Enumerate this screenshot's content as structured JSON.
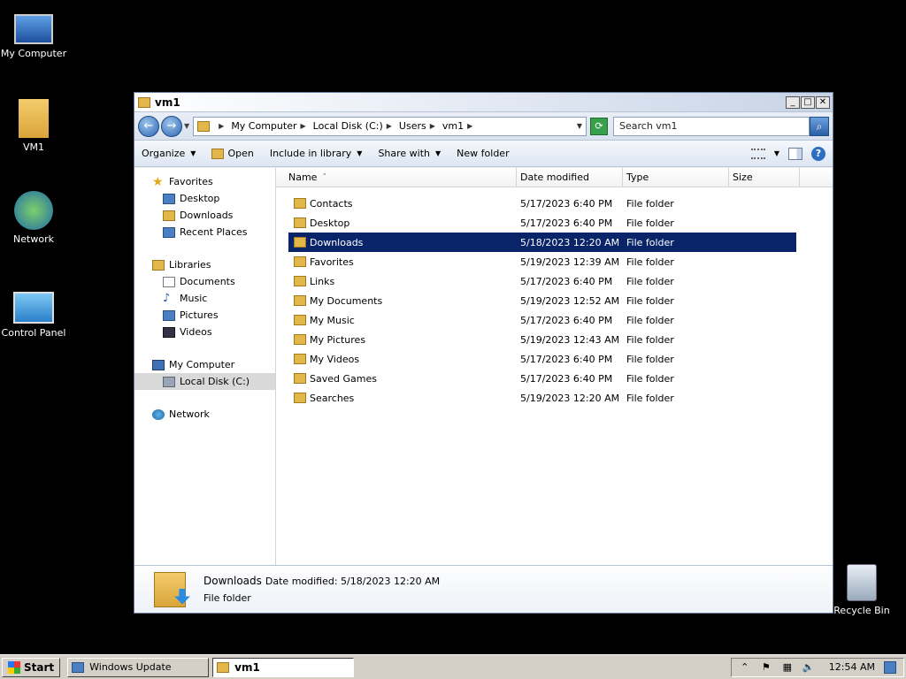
{
  "desktop": {
    "icons": [
      {
        "label": "My Computer"
      },
      {
        "label": "VM1"
      },
      {
        "label": "Network"
      },
      {
        "label": "Control Panel"
      },
      {
        "label": "Recycle Bin"
      }
    ]
  },
  "window": {
    "title": "vm1",
    "controls": {
      "minimize": "_",
      "maximize": "□",
      "close": "✕"
    },
    "address": {
      "crumbs": [
        "My Computer",
        "Local Disk (C:)",
        "Users",
        "vm1"
      ],
      "back": "←",
      "forward": "→"
    },
    "search": {
      "placeholder": "Search vm1",
      "button": "⌕"
    },
    "toolbar": {
      "organize": "Organize",
      "open": "Open",
      "include_in_library": "Include in library",
      "share_with": "Share with",
      "new_folder": "New folder",
      "help": "?"
    },
    "navpane": {
      "favorites": {
        "label": "Favorites",
        "items": [
          "Desktop",
          "Downloads",
          "Recent Places"
        ]
      },
      "libraries": {
        "label": "Libraries",
        "items": [
          "Documents",
          "Music",
          "Pictures",
          "Videos"
        ]
      },
      "computer": {
        "label": "My Computer",
        "items": [
          "Local Disk (C:)"
        ]
      },
      "network": {
        "label": "Network"
      }
    },
    "columns": {
      "name": "Name",
      "date": "Date modified",
      "type": "Type",
      "size": "Size",
      "sort_arrow": "˄"
    },
    "files": [
      {
        "name": "Contacts",
        "date": "5/17/2023 6:40 PM",
        "type": "File folder"
      },
      {
        "name": "Desktop",
        "date": "5/17/2023 6:40 PM",
        "type": "File folder"
      },
      {
        "name": "Downloads",
        "date": "5/18/2023 12:20 AM",
        "type": "File folder",
        "selected": true
      },
      {
        "name": "Favorites",
        "date": "5/19/2023 12:39 AM",
        "type": "File folder"
      },
      {
        "name": "Links",
        "date": "5/17/2023 6:40 PM",
        "type": "File folder"
      },
      {
        "name": "My Documents",
        "date": "5/19/2023 12:52 AM",
        "type": "File folder"
      },
      {
        "name": "My Music",
        "date": "5/17/2023 6:40 PM",
        "type": "File folder"
      },
      {
        "name": "My Pictures",
        "date": "5/19/2023 12:43 AM",
        "type": "File folder"
      },
      {
        "name": "My Videos",
        "date": "5/17/2023 6:40 PM",
        "type": "File folder"
      },
      {
        "name": "Saved Games",
        "date": "5/17/2023 6:40 PM",
        "type": "File folder"
      },
      {
        "name": "Searches",
        "date": "5/19/2023 12:20 AM",
        "type": "File folder"
      }
    ],
    "details": {
      "name": "Downloads",
      "meta": "Date modified: 5/18/2023 12:20 AM",
      "kind": "File folder"
    }
  },
  "taskbar": {
    "start": "Start",
    "tasks": [
      {
        "label": "Windows Update"
      },
      {
        "label": "vm1"
      }
    ],
    "tray": {
      "clock": "12:54 AM"
    }
  },
  "colors": {
    "selection": "#0a246a",
    "desktop": "#000000",
    "taskbar": "#d4d0c8"
  }
}
